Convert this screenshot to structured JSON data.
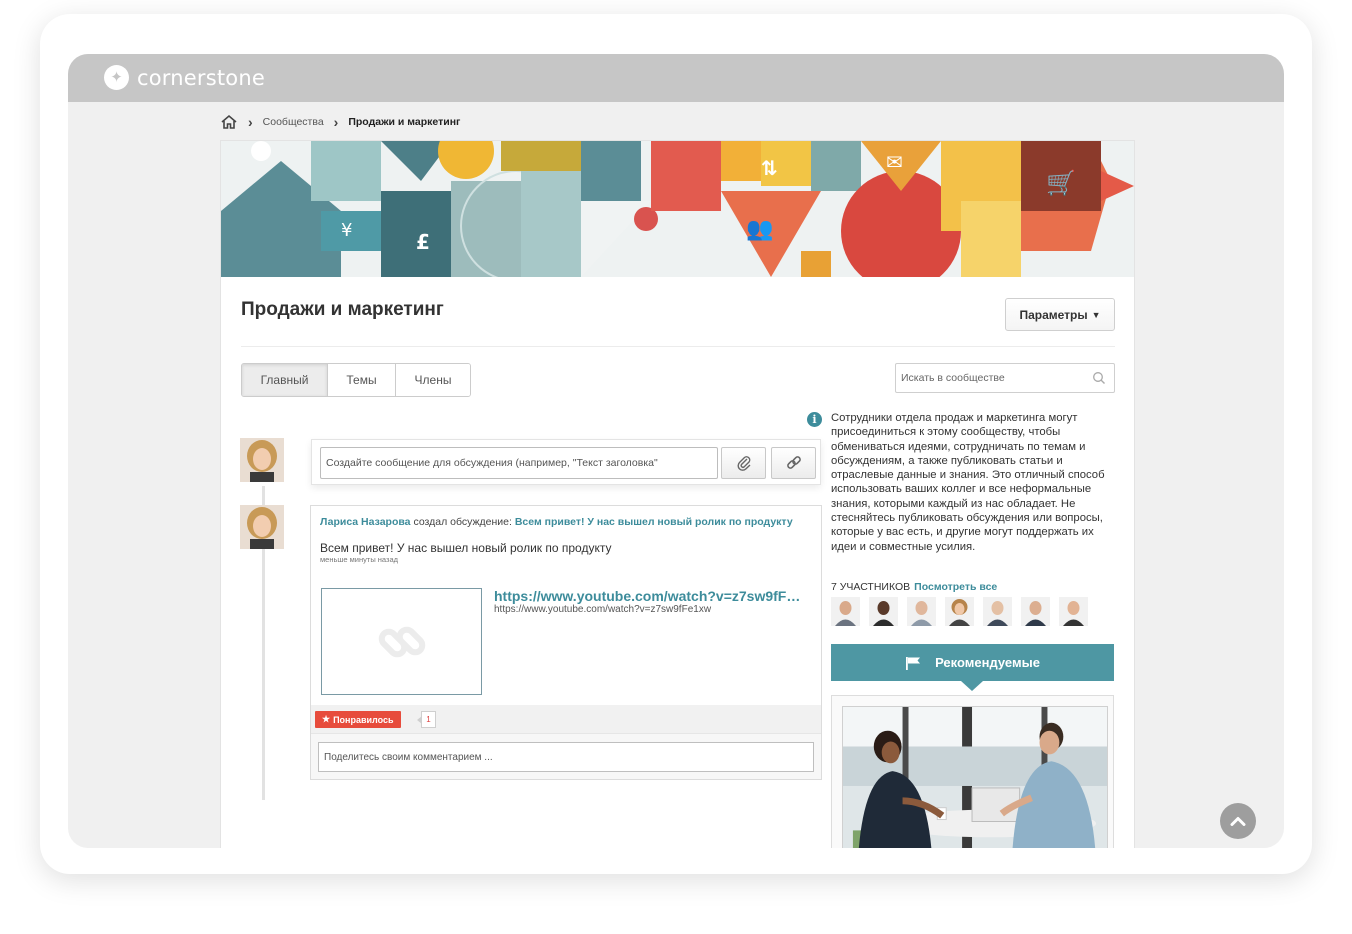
{
  "app": {
    "logo_text": "cornerstone"
  },
  "breadcrumb": {
    "home_icon": "home-icon",
    "communities": "Сообщества",
    "current": "Продажи и маркетинг"
  },
  "page": {
    "title": "Продажи и маркетинг",
    "params_button": "Параметры",
    "tabs": [
      {
        "label": "Главный",
        "active": true
      },
      {
        "label": "Темы",
        "active": false
      },
      {
        "label": "Члены",
        "active": false
      }
    ],
    "search_placeholder": "Искать в сообществе"
  },
  "compose": {
    "placeholder": "Создайте сообщение для обсуждения (например, \"Текст заголовка\"",
    "attach_icon": "paperclip-icon",
    "link_icon": "link-icon"
  },
  "post": {
    "author": "Лариса Назарова",
    "action": " создал обсуждение: ",
    "topic": "Всем привет! У нас вышел новый ролик по продукту",
    "body": "Всем привет! У нас вышел новый ролик по продукту",
    "time": "меньше минуты назад",
    "link_title": "https://www.youtube.com/watch?v=z7sw9fF…",
    "link_url": "https://www.youtube.com/watch?v=z7sw9fFe1xw",
    "like_label": "Понравилось",
    "like_count": "1",
    "comment_placeholder": "Поделитесь своим комментарием ..."
  },
  "sidebar": {
    "description": "Сотрудники отдела продаж и маркетинга могут присоединиться к этому сообществу, чтобы обмениваться идеями, сотрудничать по темам и обсуждениям, а также публиковать статьи и отраслевые данные и знания. Это отличный способ использовать ваших коллег и все неформальные знания, которыми каждый из нас обладает. Не стесняйтесь публиковать обсуждения или вопросы, которые у вас есть, и другие могут поддержать их идеи и совместные усилия.",
    "members_count_label": "7 УЧАСТНИКОВ",
    "members_link": "Посмотреть все",
    "featured_label": "Рекомендуемые"
  },
  "colors": {
    "accent": "#3d8c9b",
    "featured_bg": "#4e97a3",
    "like": "#e74c3c",
    "topbar": "#c6c6c6"
  }
}
